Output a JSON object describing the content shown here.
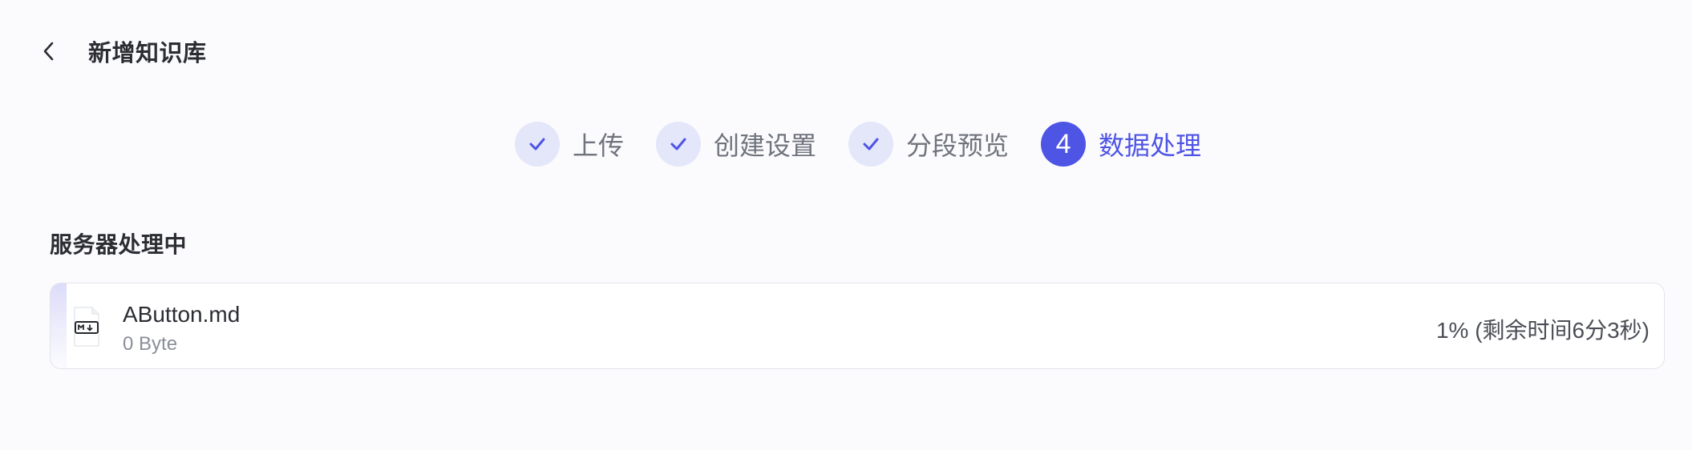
{
  "header": {
    "title": "新增知识库",
    "back_icon": "chevron-left-icon"
  },
  "steps": [
    {
      "label": "上传",
      "state": "done",
      "icon": "check-icon"
    },
    {
      "label": "创建设置",
      "state": "done",
      "icon": "check-icon"
    },
    {
      "label": "分段预览",
      "state": "done",
      "icon": "check-icon"
    },
    {
      "label": "数据处理",
      "state": "active",
      "number": "4"
    }
  ],
  "section": {
    "title": "服务器处理中"
  },
  "file": {
    "name": "AButton.md",
    "size": "0 Byte",
    "status": "1% (剩余时间6分3秒)",
    "progress": 0.01,
    "icon": "markdown-file-icon"
  },
  "colors": {
    "accent": "#4e54e4",
    "step_done_bg": "#e4e6fa",
    "page_bg": "#fbfbfe"
  }
}
